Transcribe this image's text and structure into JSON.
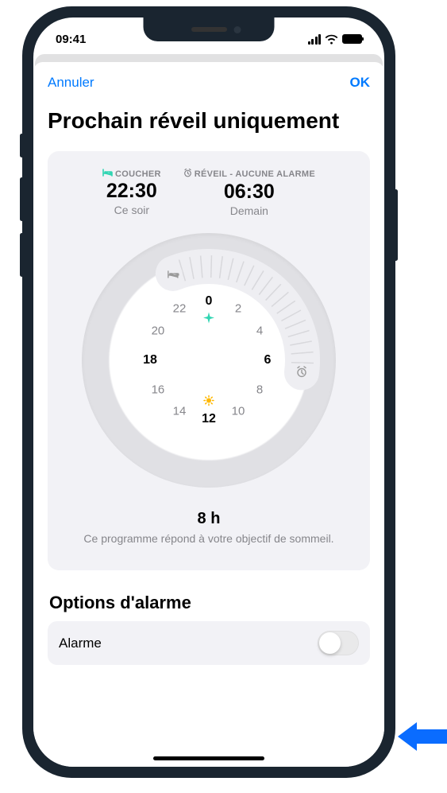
{
  "status": {
    "time": "09:41"
  },
  "modal": {
    "cancel": "Annuler",
    "ok": "OK",
    "title": "Prochain réveil uniquement"
  },
  "bedtime": {
    "label": "COUCHER",
    "time": "22:30",
    "day": "Ce soir",
    "icon_name": "bed-icon",
    "icon_color": "#30d5b2"
  },
  "wake": {
    "label": "RÉVEIL - AUCUNE ALARME",
    "time": "06:30",
    "day": "Demain",
    "icon_name": "alarm-icon"
  },
  "dial": {
    "hours": [
      "0",
      "2",
      "4",
      "6",
      "8",
      "10",
      "12",
      "14",
      "16",
      "18",
      "20",
      "22"
    ],
    "bold_hours": [
      "0",
      "6",
      "12",
      "18"
    ],
    "arc_start_hour": 22.5,
    "arc_end_hour": 6.5
  },
  "duration": {
    "hours": "8 h",
    "message": "Ce programme répond à votre objectif de sommeil."
  },
  "alarm_section": {
    "title": "Options d'alarme",
    "row_label": "Alarme",
    "toggle_on": false
  },
  "colors": {
    "accent": "#007aff",
    "teal": "#30d5b2",
    "card_bg": "#f2f2f6",
    "callout": "#0a6cff"
  }
}
